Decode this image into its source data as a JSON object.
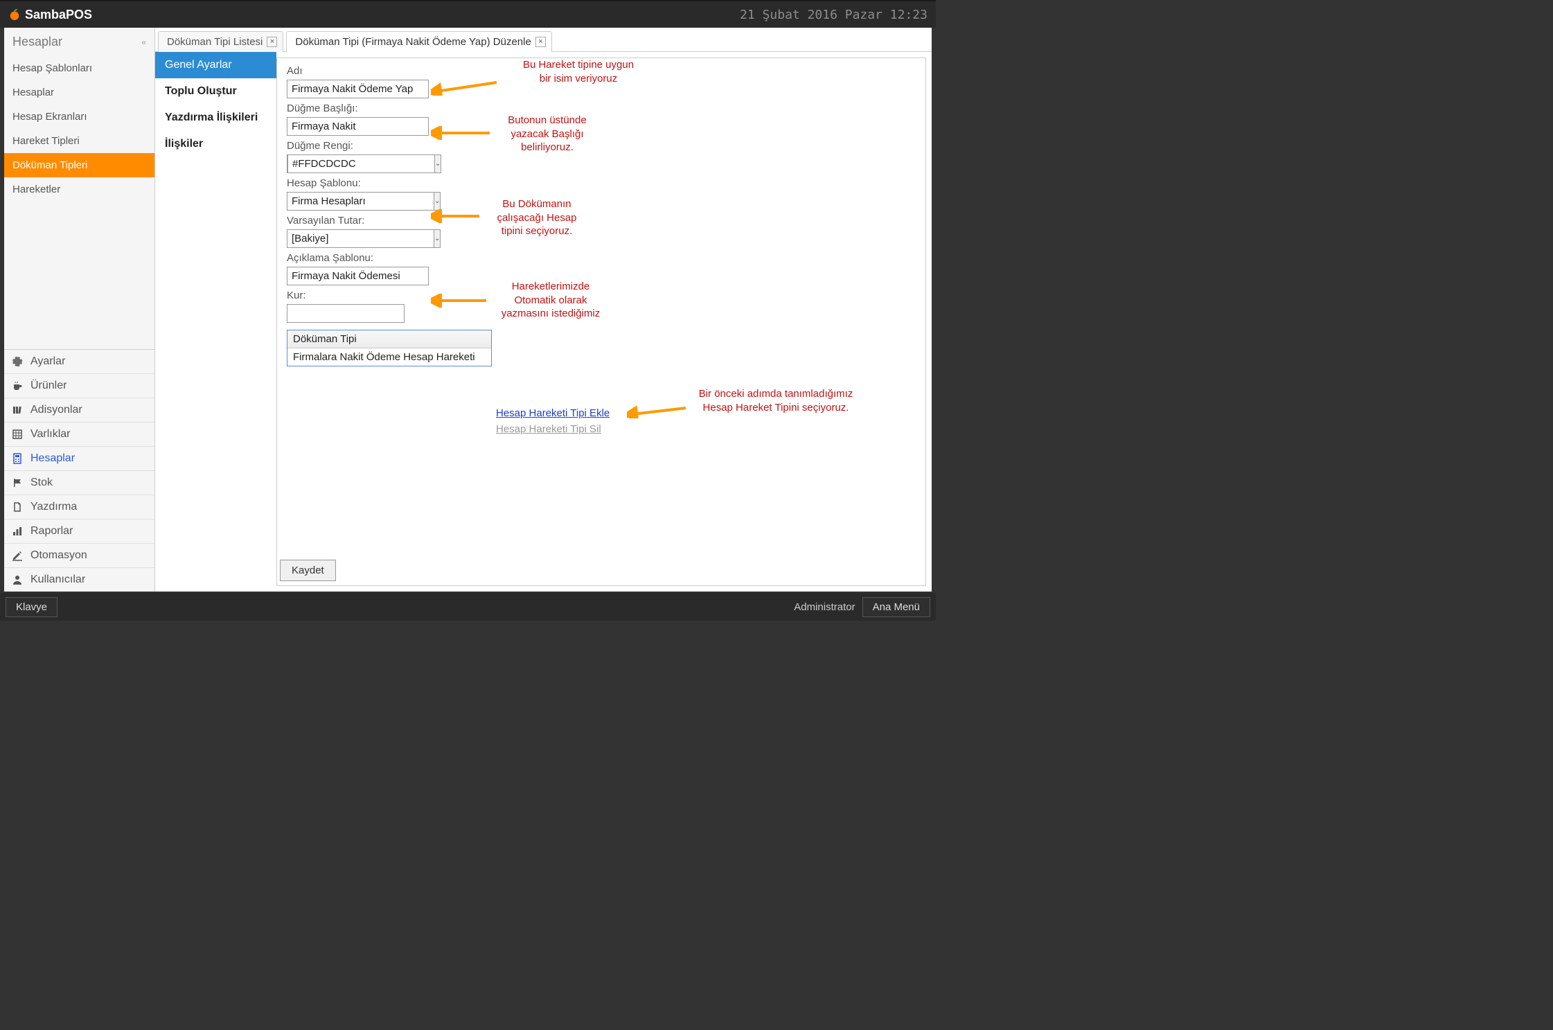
{
  "header": {
    "brand": "SambaPOS",
    "datetime": "21 Şubat 2016 Pazar 12:23"
  },
  "sidebar": {
    "title": "Hesaplar",
    "items": [
      {
        "label": "Hesap Şablonları"
      },
      {
        "label": "Hesaplar"
      },
      {
        "label": "Hesap Ekranları"
      },
      {
        "label": "Hareket Tipleri"
      },
      {
        "label": "Döküman Tipleri"
      },
      {
        "label": "Hareketler"
      }
    ],
    "nav": [
      {
        "label": "Ayarlar",
        "icon": "gear"
      },
      {
        "label": "Ürünler",
        "icon": "cup"
      },
      {
        "label": "Adisyonlar",
        "icon": "books"
      },
      {
        "label": "Varlıklar",
        "icon": "grid"
      },
      {
        "label": "Hesaplar",
        "icon": "calc"
      },
      {
        "label": "Stok",
        "icon": "flag"
      },
      {
        "label": "Yazdırma",
        "icon": "doc"
      },
      {
        "label": "Raporlar",
        "icon": "bars"
      },
      {
        "label": "Otomasyon",
        "icon": "pencil"
      },
      {
        "label": "Kullanıcılar",
        "icon": "user"
      }
    ]
  },
  "tabs": [
    {
      "label": "Döküman Tipi Listesi"
    },
    {
      "label": "Döküman Tipi (Firmaya Nakit Ödeme Yap) Düzenle"
    }
  ],
  "subnav": [
    {
      "label": "Genel Ayarlar"
    },
    {
      "label": "Toplu Oluştur"
    },
    {
      "label": "Yazdırma İlişkileri"
    },
    {
      "label": "İlişkiler"
    }
  ],
  "form": {
    "name_label": "Adı",
    "name_value": "Firmaya Nakit Ödeme Yap",
    "button_header_label": "Düğme Başlığı:",
    "button_header_value": "Firmaya Nakit",
    "button_color_label": "Düğme Rengi:",
    "button_color_value": "#FFDCDCDC",
    "account_template_label": "Hesap Şablonu:",
    "account_template_value": "Firma Hesapları",
    "default_amount_label": "Varsayılan Tutar:",
    "default_amount_value": "[Bakiye]",
    "desc_template_label": "Açıklama Şablonu:",
    "desc_template_value": "Firmaya Nakit Ödemesi",
    "rate_label": "Kur:",
    "rate_value": "",
    "list_header": "Döküman Tipi",
    "list_row": "Firmalara Nakit Ödeme Hesap Hareketi",
    "add_link": "Hesap Hareketi Tipi Ekle",
    "del_link": "Hesap Hareketi Tipi Sil",
    "save": "Kaydet"
  },
  "annotations": {
    "a1_l1": "Bu Hareket tipine uygun",
    "a1_l2": "bir isim veriyoruz",
    "a2_l1": "Butonun üstünde",
    "a2_l2": "yazacak Başlığı",
    "a2_l3": "belirliyoruz.",
    "a3_l1": "Bu Dökümanın",
    "a3_l2": "çalışacağı Hesap",
    "a3_l3": "tipini seçiyoruz.",
    "a4_l1": "Hareketlerimizde",
    "a4_l2": "Otomatik olarak",
    "a4_l3": "yazmasını istediğimiz",
    "a5_l1": "Bir önceki adımda tanımladığımız",
    "a5_l2": "Hesap Hareket Tipini seçiyoruz."
  },
  "footer": {
    "keyboard": "Klavye",
    "admin": "Administrator",
    "menu": "Ana Menü"
  }
}
